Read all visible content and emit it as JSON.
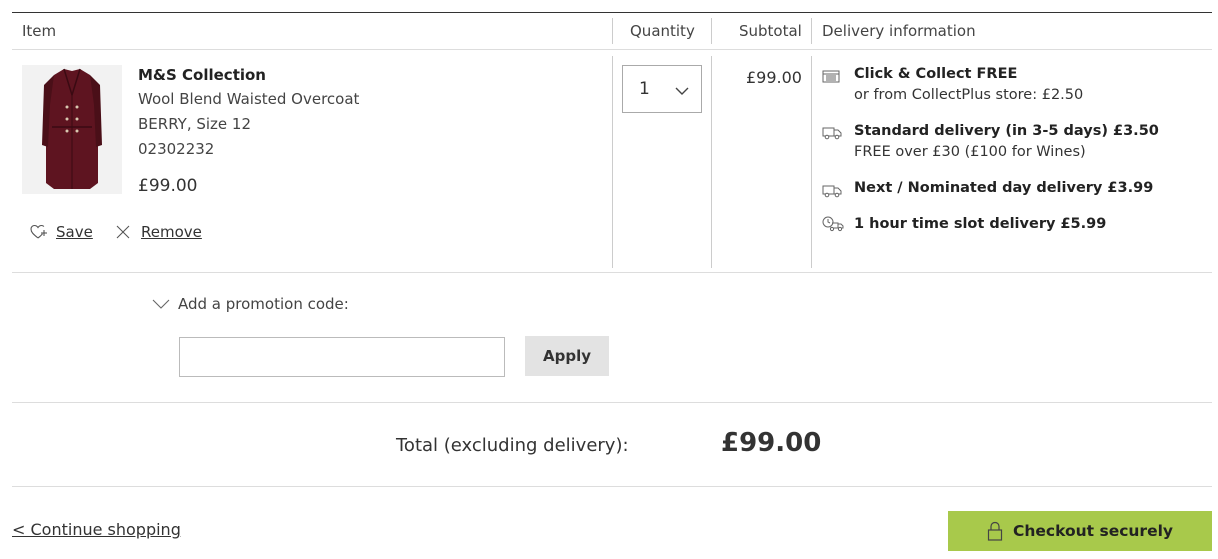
{
  "table_headers": {
    "item": "Item",
    "quantity": "Quantity",
    "subtotal": "Subtotal",
    "delivery": "Delivery information"
  },
  "product": {
    "brand": "M&S Collection",
    "name": "Wool Blend Waisted Overcoat",
    "variant": "BERRY, Size 12",
    "code": "02302232",
    "price": "£99.00",
    "image_icon": "burgundy-coat-image",
    "save_label": "Save",
    "remove_label": "Remove",
    "quantity": "1",
    "subtotal": "£99.00"
  },
  "delivery_options": [
    {
      "icon": "store-icon",
      "title": "Click & Collect FREE",
      "subtitle": "or from CollectPlus store: £2.50"
    },
    {
      "icon": "truck-icon",
      "title": "Standard delivery (in 3-5 days) £3.50",
      "subtitle": "FREE over £30 (£100 for Wines)"
    },
    {
      "icon": "truck-icon",
      "title": "Next / Nominated day delivery £3.99",
      "subtitle": ""
    },
    {
      "icon": "clock-truck-icon",
      "title": "1 hour time slot delivery £5.99",
      "subtitle": ""
    }
  ],
  "promo": {
    "toggle_label": "Add a promotion code:",
    "input_value": "",
    "apply_label": "Apply"
  },
  "total": {
    "label": "Total (excluding delivery):",
    "value": "£99.00"
  },
  "footer": {
    "continue_label": "< Continue shopping",
    "checkout_label": "Checkout securely"
  },
  "colors": {
    "checkout_bg": "#a8c94b",
    "apply_bg": "#e3e3e3",
    "product_color": "#5e1420"
  }
}
